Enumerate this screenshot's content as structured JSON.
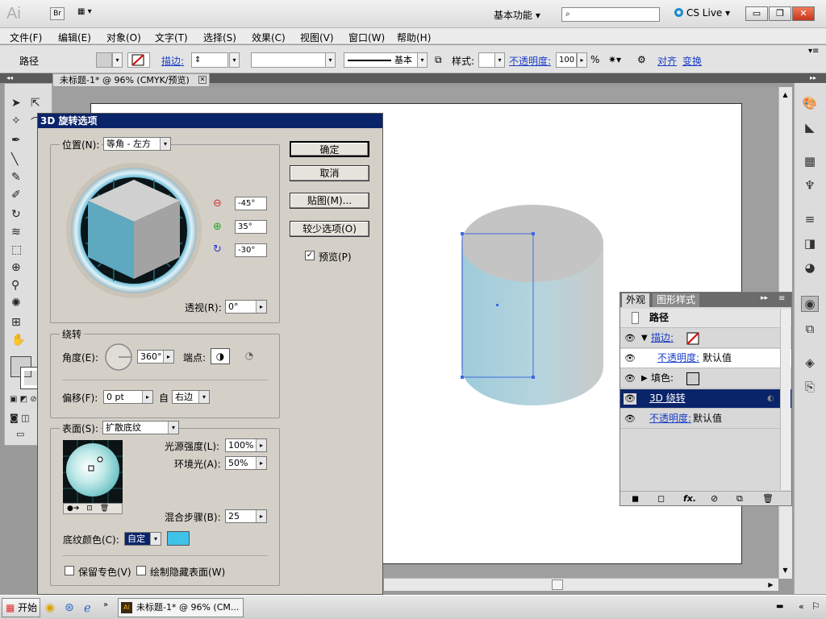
{
  "titlebar": {
    "app_logo": "Ai",
    "bridge": "Br",
    "workspace": "基本功能",
    "search_placeholder": "",
    "cs_live": "CS Live",
    "min": "▭",
    "restore": "❐",
    "close": "✕"
  },
  "menu": [
    "文件(F)",
    "编辑(E)",
    "对象(O)",
    "文字(T)",
    "选择(S)",
    "效果(C)",
    "视图(V)",
    "窗口(W)",
    "帮助(H)"
  ],
  "control": {
    "type_label": "路径",
    "stroke_label": "描边:",
    "stroke_style": "基本",
    "style_label": "样式:",
    "opacity_label": "不透明度:",
    "opacity_value": "100",
    "percent": "%",
    "align": "对齐",
    "transform": "变换"
  },
  "document_tab": {
    "title": "未标题-1* @ 96% (CMYK/预览)"
  },
  "dialog": {
    "title": "3D 旋转选项",
    "position_label": "位置(N):",
    "position_value": "等角 - 左方",
    "rot_x": "-45°",
    "rot_y": "35°",
    "rot_z": "-30°",
    "perspective_label": "透视(R):",
    "perspective_value": "0°",
    "revolve_group": "绕转",
    "angle_label": "角度(E):",
    "angle_value": "360°",
    "cap_label": "端点:",
    "offset_label": "偏移(F):",
    "offset_value": "0 pt",
    "from_label": "自",
    "from_value": "右边",
    "surface_label": "表面(S):",
    "surface_value": "扩散底纹",
    "light_intensity_label": "光源强度(L):",
    "light_intensity_value": "100%",
    "ambient_label": "环境光(A):",
    "ambient_value": "50%",
    "blend_steps_label": "混合步骤(B):",
    "blend_steps_value": "25",
    "shade_color_label": "底纹颜色(C):",
    "shade_color_value": "自定",
    "shade_color": "#3ec2e8",
    "preserve_spot": "保留专色(V)",
    "draw_hidden": "绘制隐藏表面(W)",
    "ok": "确定",
    "cancel": "取消",
    "map_art": "贴图(M)...",
    "fewer_options": "较少选项(O)",
    "preview": "预览(P)"
  },
  "appearance": {
    "tab_appearance": "外观",
    "tab_graphic_styles": "图形样式",
    "title": "路径",
    "stroke": "描边:",
    "stroke_opacity_label": "不透明度:",
    "stroke_opacity_value": "默认值",
    "fill": "填色:",
    "effect": "3D 绕转",
    "opacity_label": "不透明度:",
    "opacity_value": "默认值"
  },
  "taskbar": {
    "start": "开始",
    "task": "未标题-1* @ 96% (CM..."
  }
}
